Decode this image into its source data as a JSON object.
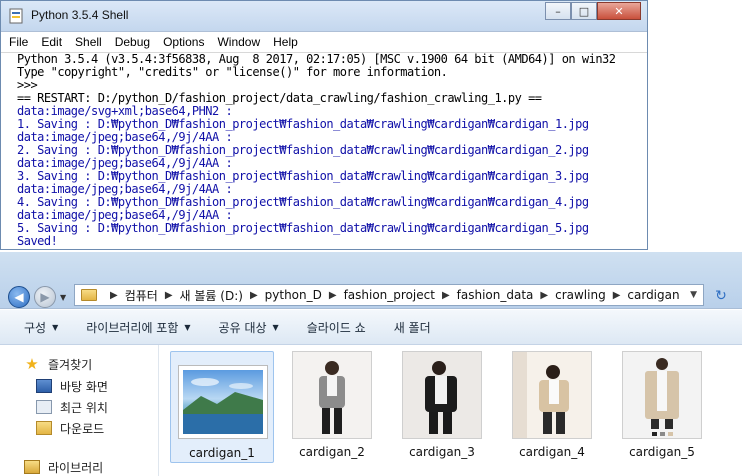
{
  "shell": {
    "title": "Python 3.5.4 Shell",
    "menu": [
      "File",
      "Edit",
      "Shell",
      "Debug",
      "Options",
      "Window",
      "Help"
    ],
    "lines": [
      "Python 3.5.4 (v3.5.4:3f56838, Aug  8 2017, 02:17:05) [MSC v.1900 64 bit (AMD64)] on win32",
      "Type \"copyright\", \"credits\" or \"license()\" for more information.",
      ">>> ",
      "== RESTART: D:/python_D/fashion_project/data_crawling/fashion_crawling_1.py ==",
      "data:image/svg+xml;base64,PHN2 :",
      "1. Saving : D:₩python_D₩fashion_project₩fashion_data₩crawling₩cardigan₩cardigan_1.jpg",
      "data:image/jpeg;base64,/9j/4AA :",
      "2. Saving : D:₩python_D₩fashion_project₩fashion_data₩crawling₩cardigan₩cardigan_2.jpg",
      "data:image/jpeg;base64,/9j/4AA :",
      "3. Saving : D:₩python_D₩fashion_project₩fashion_data₩crawling₩cardigan₩cardigan_3.jpg",
      "data:image/jpeg;base64,/9j/4AA :",
      "4. Saving : D:₩python_D₩fashion_project₩fashion_data₩crawling₩cardigan₩cardigan_4.jpg",
      "data:image/jpeg;base64,/9j/4AA :",
      "5. Saving : D:₩python_D₩fashion_project₩fashion_data₩crawling₩cardigan₩cardigan_5.jpg",
      "Saved!"
    ],
    "line_colors": [
      "#000000",
      "#000000",
      "#000000",
      "#000000",
      "#1010a8",
      "#1010a8",
      "#1010a8",
      "#1010a8",
      "#1010a8",
      "#1010a8",
      "#1010a8",
      "#1010a8",
      "#1010a8",
      "#1010a8",
      "#1010a8"
    ]
  },
  "explorer": {
    "breadcrumb": [
      "컴퓨터",
      "새 볼륨 (D:)",
      "python_D",
      "fashion_project",
      "fashion_data",
      "crawling",
      "cardigan"
    ],
    "toolbar": [
      {
        "label": "구성",
        "dropdown": true
      },
      {
        "label": "라이브러리에 포함",
        "dropdown": true
      },
      {
        "label": "공유 대상",
        "dropdown": true
      },
      {
        "label": "슬라이드 쇼",
        "dropdown": false
      },
      {
        "label": "새 폴더",
        "dropdown": false
      }
    ],
    "nav": {
      "favorites": "즐겨찾기",
      "desktop": "바탕 화면",
      "recent": "최근 위치",
      "downloads": "다운로드",
      "libraries": "라이브러리"
    },
    "files": [
      {
        "name": "cardigan_1",
        "selected": true
      },
      {
        "name": "cardigan_2",
        "selected": false
      },
      {
        "name": "cardigan_3",
        "selected": false
      },
      {
        "name": "cardigan_4",
        "selected": false
      },
      {
        "name": "cardigan_5",
        "selected": false
      }
    ]
  }
}
